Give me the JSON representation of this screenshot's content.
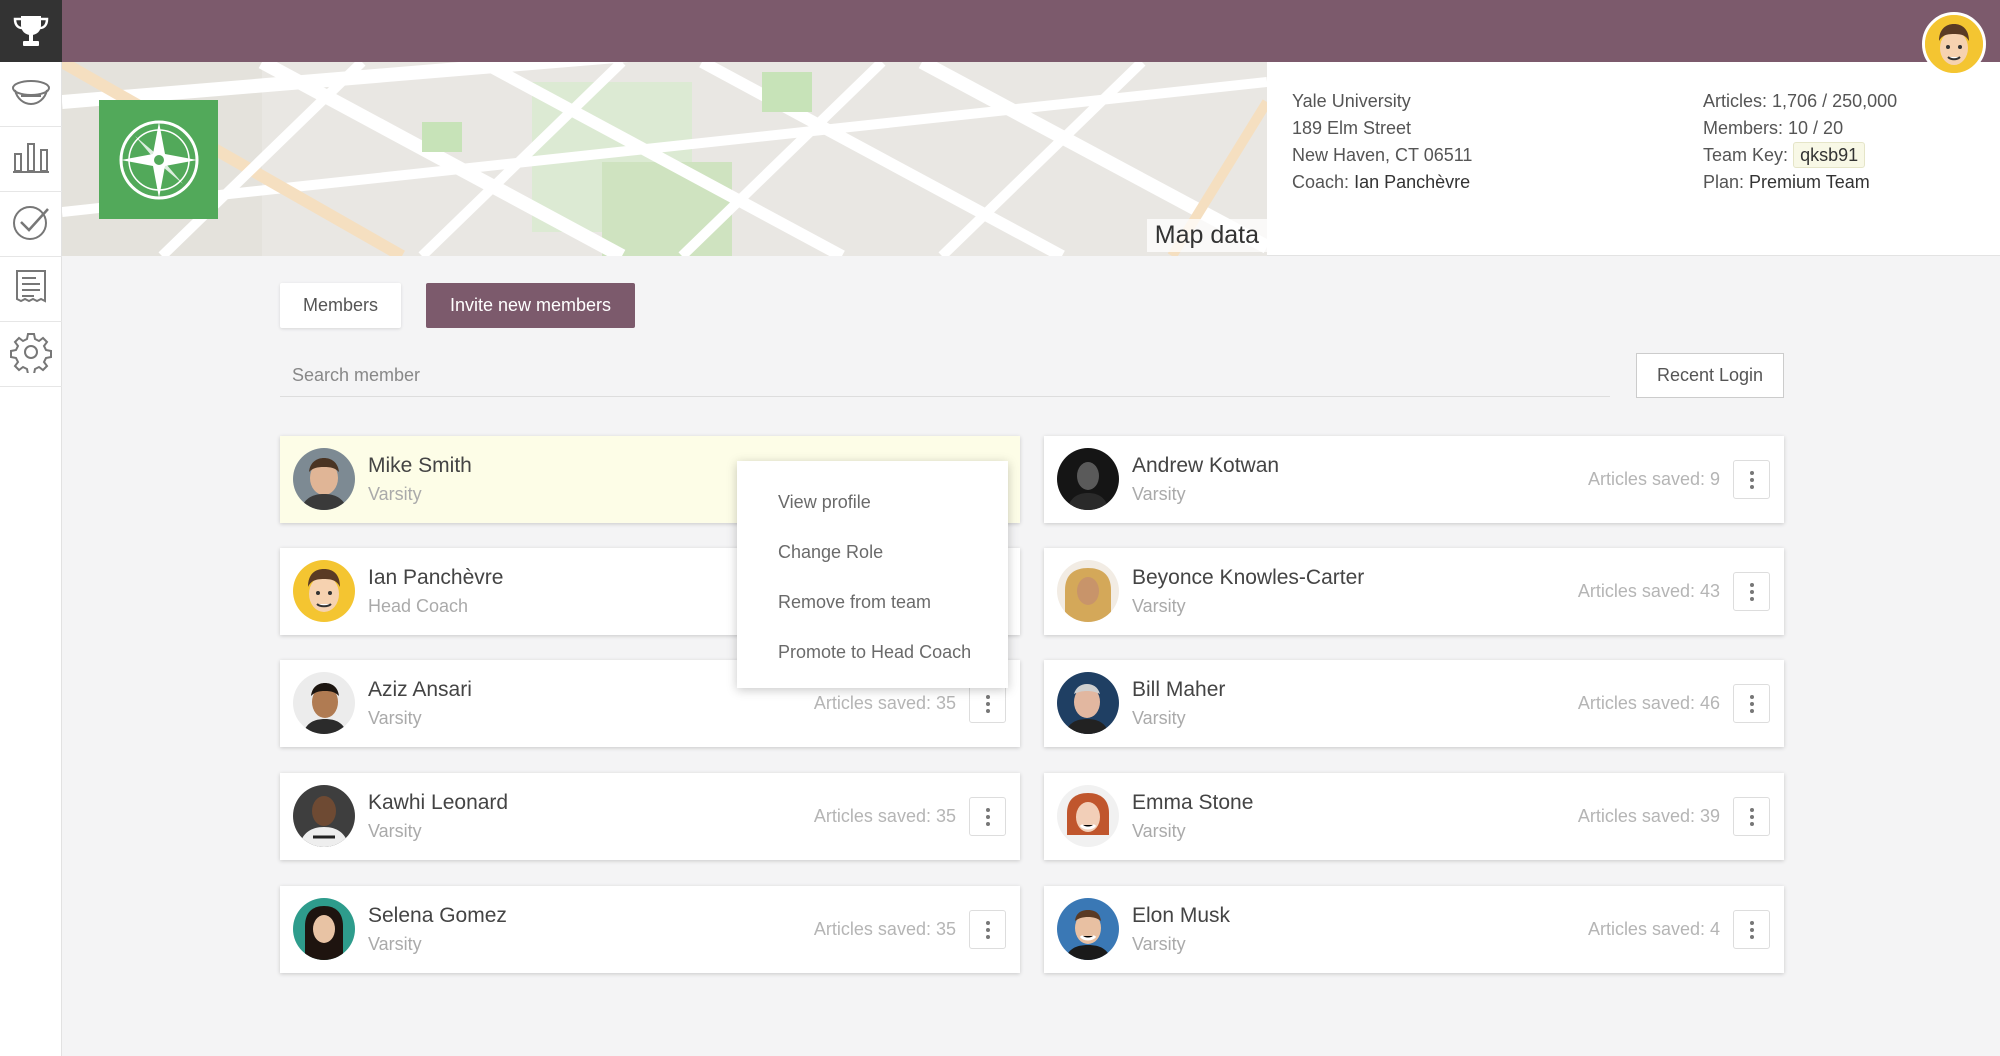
{
  "app": {
    "brand_icon": "trophy-icon"
  },
  "sidebar": {
    "items": [
      {
        "name": "dashboard",
        "icon": "bowl-icon"
      },
      {
        "name": "stats",
        "icon": "bar-chart-icon"
      },
      {
        "name": "tasks",
        "icon": "checkmark-icon"
      },
      {
        "name": "billing",
        "icon": "receipt-icon"
      },
      {
        "name": "settings",
        "icon": "gear-icon"
      }
    ]
  },
  "colors": {
    "brand": "#7c5a6c",
    "team_logo": "#52a95a",
    "highlight": "#fdfde7"
  },
  "map": {
    "credit": "Map data"
  },
  "team": {
    "name": "Yale University",
    "street": "189 Elm Street",
    "city": "New Haven, CT 06511",
    "coach_label": "Coach:",
    "coach": "Ian Panchèvre",
    "articles_label": "Articles:",
    "articles": "1,706 / 250,000",
    "members_label": "Members:",
    "members": "10 / 20",
    "key_label": "Team Key:",
    "key": "qksb91",
    "plan_label": "Plan:",
    "plan": "Premium Team"
  },
  "tabs": {
    "members": "Members",
    "invite": "Invite new members"
  },
  "search": {
    "placeholder": "Search member"
  },
  "sort": {
    "recent_login": "Recent Login"
  },
  "members": [
    {
      "name": "Mike Smith",
      "role": "Varsity",
      "saved": ""
    },
    {
      "name": "Andrew Kotwan",
      "role": "Varsity",
      "saved": "Articles saved: 9"
    },
    {
      "name": "Ian Panchèvre",
      "role": "Head Coach",
      "saved": ""
    },
    {
      "name": "Beyonce Knowles-Carter",
      "role": "Varsity",
      "saved": "Articles saved: 43"
    },
    {
      "name": "Aziz Ansari",
      "role": "Varsity",
      "saved": "Articles saved: 35"
    },
    {
      "name": "Bill Maher",
      "role": "Varsity",
      "saved": "Articles saved: 46"
    },
    {
      "name": "Kawhi Leonard",
      "role": "Varsity",
      "saved": "Articles saved: 35"
    },
    {
      "name": "Emma Stone",
      "role": "Varsity",
      "saved": "Articles saved: 39"
    },
    {
      "name": "Selena Gomez",
      "role": "Varsity",
      "saved": "Articles saved: 35"
    },
    {
      "name": "Elon Musk",
      "role": "Varsity",
      "saved": "Articles saved: 4"
    }
  ],
  "context_menu": {
    "items": [
      "View profile",
      "Change Role",
      "Remove from team",
      "Promote to Head Coach"
    ]
  }
}
